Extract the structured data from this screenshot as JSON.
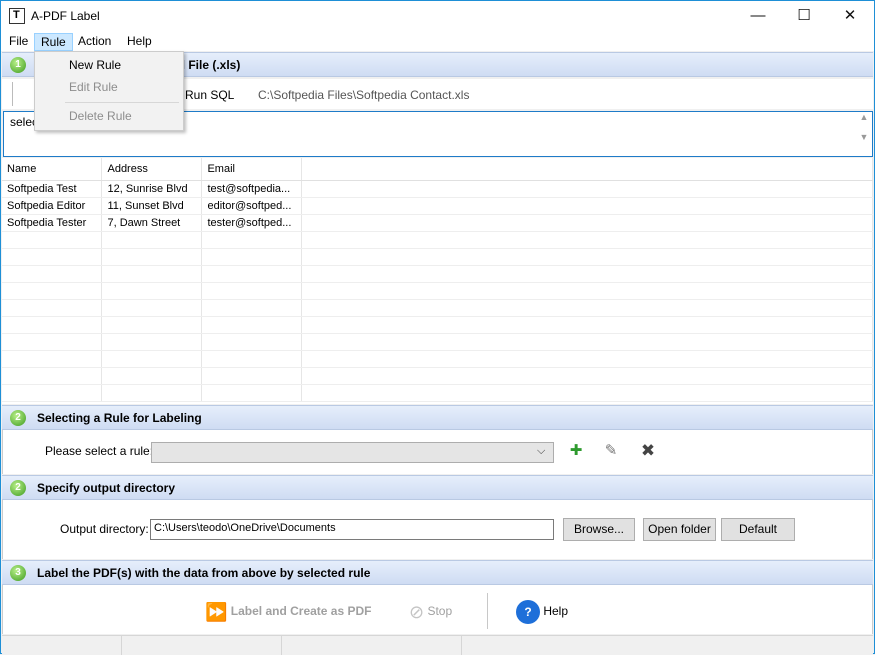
{
  "window": {
    "title": "A-PDF Label",
    "minimize_glyph": "—",
    "maximize_glyph": "☐",
    "close_glyph": "✕"
  },
  "menu": {
    "items": [
      "File",
      "Rule",
      "Action",
      "Help"
    ],
    "active": "Rule"
  },
  "rule_menu": {
    "new_rule": "New Rule",
    "edit_rule": "Edit Rule",
    "delete_rule": "Delete Rule"
  },
  "section1": {
    "number": "1",
    "title_visible": "el File (.xls)"
  },
  "toolbar1": {
    "run_sql": "Run SQL",
    "file_path": "C:\\Softpedia Files\\Softpedia Contact.xls"
  },
  "sql": {
    "text": "selec"
  },
  "grid": {
    "columns": [
      "Name",
      "Address",
      "Email"
    ],
    "rows": [
      [
        "Softpedia Test",
        "12, Sunrise Blvd",
        "test@softpedia..."
      ],
      [
        "Softpedia Editor",
        "11, Sunset Blvd",
        "editor@softped..."
      ],
      [
        "Softpedia Tester",
        "7, Dawn Street",
        "tester@softped..."
      ]
    ]
  },
  "section2": {
    "number": "2",
    "title": "Selecting a Rule for Labeling",
    "select_label": "Please select a rule:",
    "select_value": ""
  },
  "section3": {
    "number": "2",
    "title": "Specify output directory",
    "dir_label": "Output directory:",
    "dir_value": "C:\\Users\\teodo\\OneDrive\\Documents",
    "browse": "Browse...",
    "open_folder": "Open folder",
    "default": "Default"
  },
  "section4": {
    "number": "3",
    "title": "Label the PDF(s) with the data from above by selected rule",
    "label_create": "Label and Create as PDF",
    "stop": "Stop",
    "help": "Help"
  },
  "colors": {
    "header_band": "#cfdcf3",
    "accent": "#1e8fd6",
    "step_badge": "#3d9a1e"
  },
  "icons": [
    "app-icon",
    "step-number-icon",
    "add-rule-icon",
    "edit-rule-icon",
    "delete-rule-icon",
    "label-create-icon",
    "stop-icon",
    "help-icon"
  ]
}
